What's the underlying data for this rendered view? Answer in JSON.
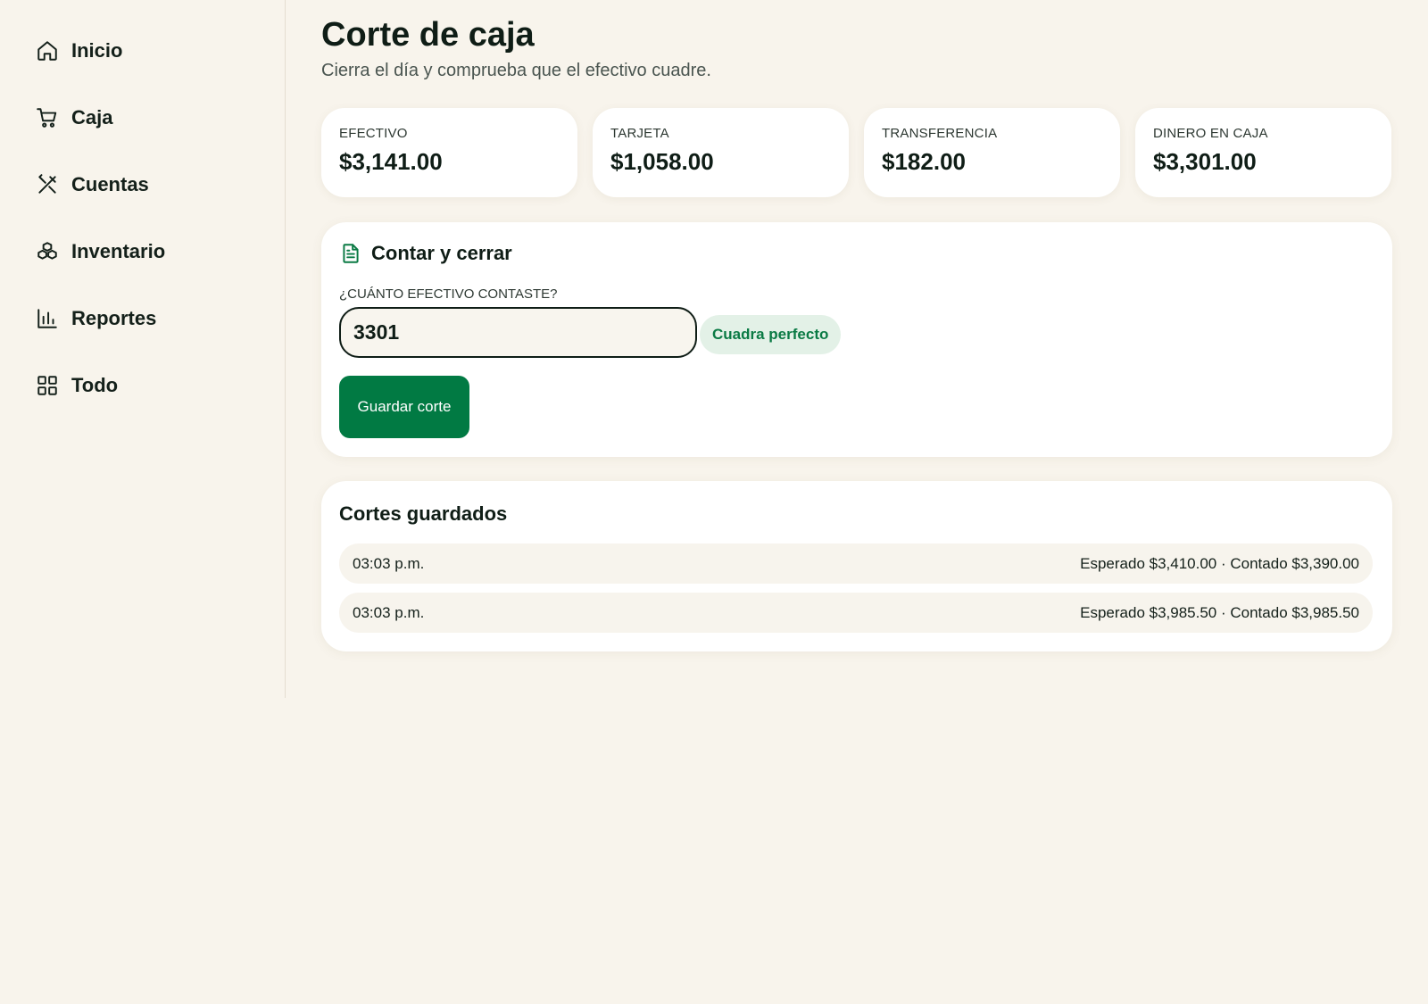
{
  "sidebar": {
    "items": [
      {
        "label": "Inicio",
        "icon": "home-icon"
      },
      {
        "label": "Caja",
        "icon": "cart-icon"
      },
      {
        "label": "Cuentas",
        "icon": "utensils-icon"
      },
      {
        "label": "Inventario",
        "icon": "boxes-icon"
      },
      {
        "label": "Reportes",
        "icon": "bar-chart-icon"
      },
      {
        "label": "Todo",
        "icon": "grid-icon"
      }
    ]
  },
  "header": {
    "title": "Corte de caja",
    "subtitle": "Cierra el día y comprueba que el efectivo cuadre."
  },
  "stats": [
    {
      "label": "EFECTIVO",
      "value": "$3,141.00"
    },
    {
      "label": "TARJETA",
      "value": "$1,058.00"
    },
    {
      "label": "TRANSFERENCIA",
      "value": "$182.00"
    },
    {
      "label": "DINERO EN CAJA",
      "value": "$3,301.00"
    }
  ],
  "close_panel": {
    "title": "Contar y cerrar",
    "icon": "document-icon",
    "field_label": "¿CUÁNTO EFECTIVO CONTASTE?",
    "cash_value": "3301",
    "status": "Cuadra perfecto",
    "save_label": "Guardar corte"
  },
  "history": {
    "title": "Cortes guardados",
    "rows": [
      {
        "time": "03:03 p.m.",
        "summary": "Esperado $3,410.00 · Contado $3,390.00"
      },
      {
        "time": "03:03 p.m.",
        "summary": "Esperado $3,985.50 · Contado $3,985.50"
      }
    ]
  },
  "colors": {
    "accent": "#017a43",
    "background": "#f8f4ec",
    "status_bg": "#e3f1e7"
  }
}
